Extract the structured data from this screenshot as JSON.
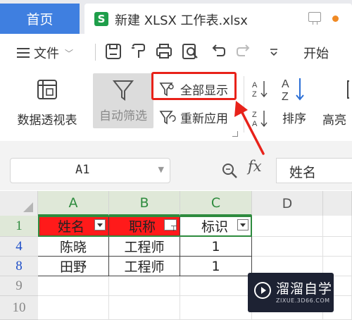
{
  "tabs": {
    "home_label": "首页",
    "doc_icon_letter": "S",
    "doc_title": "新建 XLSX 工作表.xlsx",
    "dot_color": "#f08a24"
  },
  "quickbar": {
    "file_menu": "文件",
    "start_menu": "开始",
    "icons": [
      "save-icon",
      "format-painter-icon",
      "print-icon",
      "print-preview-icon",
      "undo-icon",
      "redo-icon",
      "more-dropdown-icon"
    ]
  },
  "ribbon": {
    "pivot_label": "数据透视表",
    "autofilter_label": "自动筛选",
    "show_all_label": "全部显示",
    "reapply_label": "重新应用",
    "sort_label": "排序",
    "highlight_label": "高亮",
    "highlight_box_color": "#e8221a"
  },
  "formula_bar": {
    "cell_ref": "A1",
    "fx_label": "fx",
    "content": "姓名"
  },
  "sheet": {
    "columns": [
      "A",
      "B",
      "C",
      "D"
    ],
    "rows": [
      "1",
      "4",
      "8",
      "9",
      "10"
    ],
    "header": [
      "姓名",
      "职称",
      "标识"
    ],
    "data": [
      [
        "陈晓",
        "工程师",
        "1"
      ],
      [
        "田野",
        "工程师",
        "1"
      ]
    ],
    "header_fill": "#ff1a1a",
    "selection_color": "#2e8b3e"
  },
  "watermark": {
    "name": "溜溜自学",
    "url": "ZIXUE.3D66.COM"
  }
}
